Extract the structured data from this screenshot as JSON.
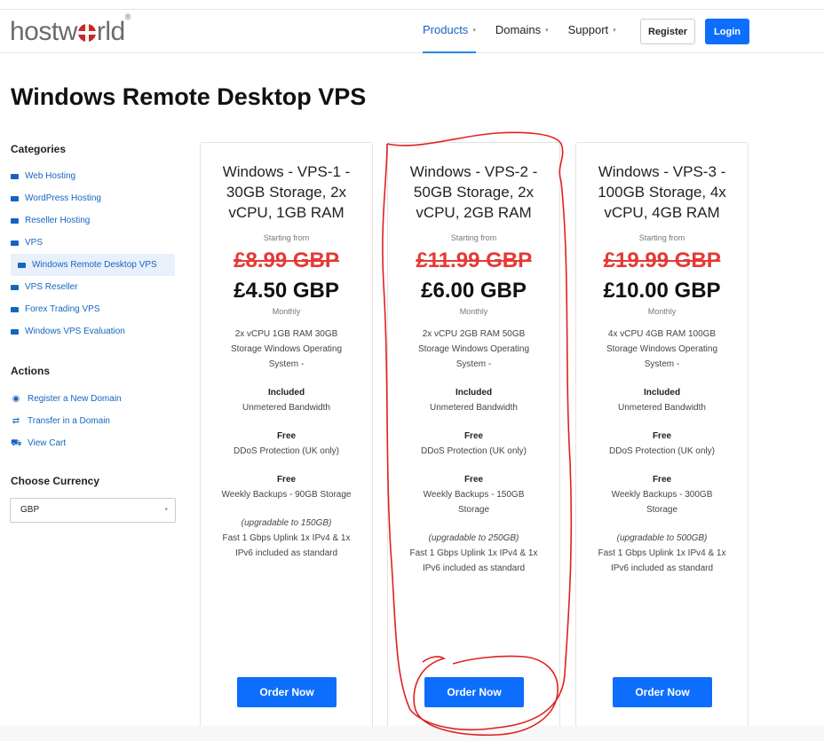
{
  "brand": {
    "logo_pre": "host",
    "logo_post": "rld",
    "logo_mark": "®"
  },
  "nav": {
    "items": [
      {
        "label": "Products",
        "caret": "▾"
      },
      {
        "label": "Domains",
        "caret": "▾"
      },
      {
        "label": "Support",
        "caret": "▾"
      }
    ],
    "register_label": "Register",
    "login_label": "Login"
  },
  "page": {
    "title": "Windows Remote Desktop VPS"
  },
  "sidebar": {
    "categories_heading": "Categories",
    "categories": [
      {
        "label": "Web Hosting"
      },
      {
        "label": "WordPress Hosting"
      },
      {
        "label": "Reseller Hosting"
      },
      {
        "label": "VPS"
      },
      {
        "label": "Windows Remote Desktop VPS"
      },
      {
        "label": "VPS Reseller"
      },
      {
        "label": "Forex Trading VPS"
      },
      {
        "label": "Windows VPS Evaluation"
      }
    ],
    "actions_heading": "Actions",
    "actions": [
      {
        "label": "Register a New Domain",
        "icon": "globe-icon"
      },
      {
        "label": "Transfer in a Domain",
        "icon": "transfer-icon"
      },
      {
        "label": "View Cart",
        "icon": "cart-icon"
      }
    ],
    "currency_heading": "Choose Currency",
    "currency_value": "GBP",
    "currency_caret": "▾"
  },
  "products": [
    {
      "title": "Windows - VPS-1 - 30GB Storage, 2x vCPU, 1GB RAM",
      "starting_from": "Starting from",
      "old_price": "£8.99 GBP",
      "new_price": "£4.50 GBP",
      "period": "Monthly",
      "spec": "2x vCPU 1GB RAM 30GB Storage Windows Operating System -",
      "included_label": "Included",
      "included_value": "Unmetered Bandwidth",
      "ddos_label": "Free",
      "ddos_value": "DDoS Protection (UK only)",
      "backup_label": "Free",
      "backup_value": "Weekly Backups - 90GB Storage",
      "upgrade_note": "(upgradable to 150GB)",
      "uplink": "Fast 1 Gbps Uplink 1x IPv4 & 1x IPv6 included as standard",
      "order_label": "Order Now"
    },
    {
      "title": "Windows - VPS-2 - 50GB Storage, 2x vCPU, 2GB RAM",
      "starting_from": "Starting from",
      "old_price": "£11.99 GBP",
      "new_price": "£6.00 GBP",
      "period": "Monthly",
      "spec": "2x vCPU 2GB RAM 50GB Storage Windows Operating System -",
      "included_label": "Included",
      "included_value": "Unmetered Bandwidth",
      "ddos_label": "Free",
      "ddos_value": "DDoS Protection (UK only)",
      "backup_label": "Free",
      "backup_value": "Weekly Backups - 150GB Storage",
      "upgrade_note": "(upgradable to 250GB)",
      "uplink": "Fast 1 Gbps Uplink 1x IPv4 & 1x IPv6 included as standard",
      "order_label": "Order Now"
    },
    {
      "title": "Windows - VPS-3 - 100GB Storage, 4x vCPU, 4GB RAM",
      "starting_from": "Starting from",
      "old_price": "£19.99 GBP",
      "new_price": "£10.00 GBP",
      "period": "Monthly",
      "spec": "4x vCPU 4GB RAM 100GB Storage Windows Operating System -",
      "included_label": "Included",
      "included_value": "Unmetered Bandwidth",
      "ddos_label": "Free",
      "ddos_value": "DDoS Protection (UK only)",
      "backup_label": "Free",
      "backup_value": "Weekly Backups - 300GB Storage",
      "upgrade_note": "(upgradable to 500GB)",
      "uplink": "Fast 1 Gbps Uplink 1x IPv4 & 1x IPv6 included as standard",
      "order_label": "Order Now"
    }
  ],
  "colors": {
    "accent": "#0d6efd",
    "link": "#1565c0",
    "strike": "#e53935",
    "annotation": "#e02020"
  }
}
